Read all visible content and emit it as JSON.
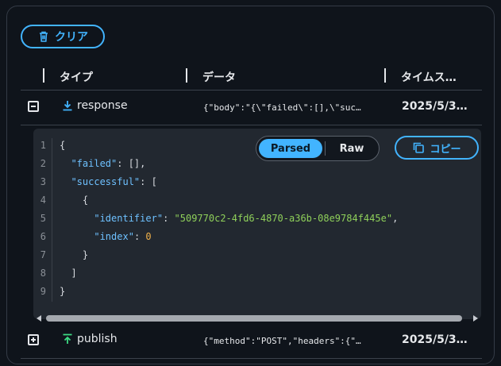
{
  "toolbar": {
    "clear_label": "クリア"
  },
  "table": {
    "columns": [
      "タイプ",
      "データ",
      "タイムス…"
    ],
    "rows": [
      {
        "type": "response",
        "data": "{\"body\":\"{\\\"failed\\\":[],\\\"suc…",
        "time": "2025/5/3…",
        "expanded": true
      },
      {
        "type": "publish",
        "data": "{\"method\":\"POST\",\"headers\":{\"…",
        "time": "2025/5/3…",
        "expanded": false
      }
    ]
  },
  "detail": {
    "view_modes": {
      "parsed": "Parsed",
      "raw": "Raw",
      "selected": "Parsed"
    },
    "copy_label": "コピー",
    "line_numbers": [
      "1",
      "2",
      "3",
      "4",
      "5",
      "6",
      "7",
      "8",
      "9"
    ],
    "json": {
      "failed_key": "\"failed\"",
      "successful_key": "\"successful\"",
      "identifier_key": "\"identifier\"",
      "identifier_value": "\"509770c2-4fd6-4870-a36b-08e9784f445e\"",
      "index_key": "\"index\"",
      "index_value": "0"
    }
  },
  "colors": {
    "accent": "#42b4ff",
    "response_icon": "#42b4ff",
    "publish_icon": "#3ddc84",
    "key": "#6ec1ff",
    "string": "#8fd05a",
    "number": "#f0b14a"
  }
}
